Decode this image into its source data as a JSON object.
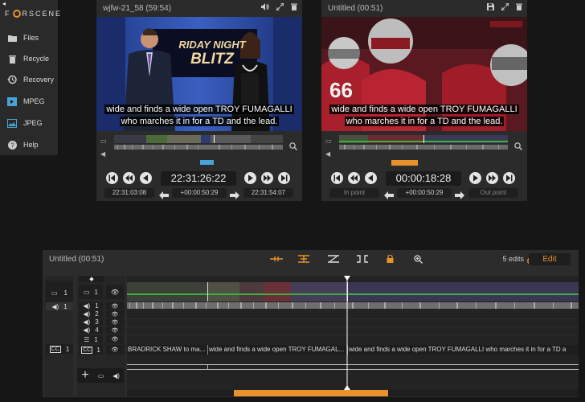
{
  "app": {
    "logo_left": "F",
    "logo_right": "RSCENE"
  },
  "sidebar": {
    "items": [
      {
        "label": "Files",
        "icon": "folder-icon"
      },
      {
        "label": "Recycle",
        "icon": "trash-icon"
      },
      {
        "label": "Recovery",
        "icon": "history-icon"
      },
      {
        "label": "MPEG",
        "icon": "film-icon"
      },
      {
        "label": "JPEG",
        "icon": "image-icon"
      },
      {
        "label": "Help",
        "icon": "help-icon"
      }
    ]
  },
  "source_viewer": {
    "title": "wjfw-21_58 (59:54)",
    "caption_line1": "wide and finds a wide open TROY FUMAGALLI",
    "caption_line2": "who marches it in for a TD and the lead.",
    "graphic_text_1": "RIDAY NIGHT",
    "graphic_text_2": "BLITZ",
    "timecode": "22:31:26:22",
    "in_tc": "22:31:03:08",
    "duration_tc": "+00:00:50:29",
    "out_tc": "22:31:54:07"
  },
  "sequence_viewer": {
    "title": "Untitled (00:51)",
    "caption_line1": "wide and finds a wide open TROY FUMAGALLI",
    "caption_line2": "who marches it in for a TD and the lead.",
    "jersey_number": "66",
    "timecode": "00:00:18:28",
    "in_label": "In point",
    "duration_tc": "+00:00:50:29",
    "out_label": "Out point"
  },
  "timeline": {
    "title": "Untitled (00:51)",
    "edits": "5 edits",
    "edit_button": "Edit",
    "video_track_count": "1",
    "audio_rows": [
      "1",
      "2",
      "3",
      "4"
    ],
    "caption_track_count": "1",
    "caption_clips": [
      "BRADRICK SHAW to ma...",
      "wide and finds a wide open TROY FUMAGAL...",
      "wide and finds a wide open TROY FUMAGALLI who marches it in for a TD a"
    ]
  },
  "colors": {
    "accent": "#e8912d",
    "source_bar": "#4aa3d8"
  }
}
